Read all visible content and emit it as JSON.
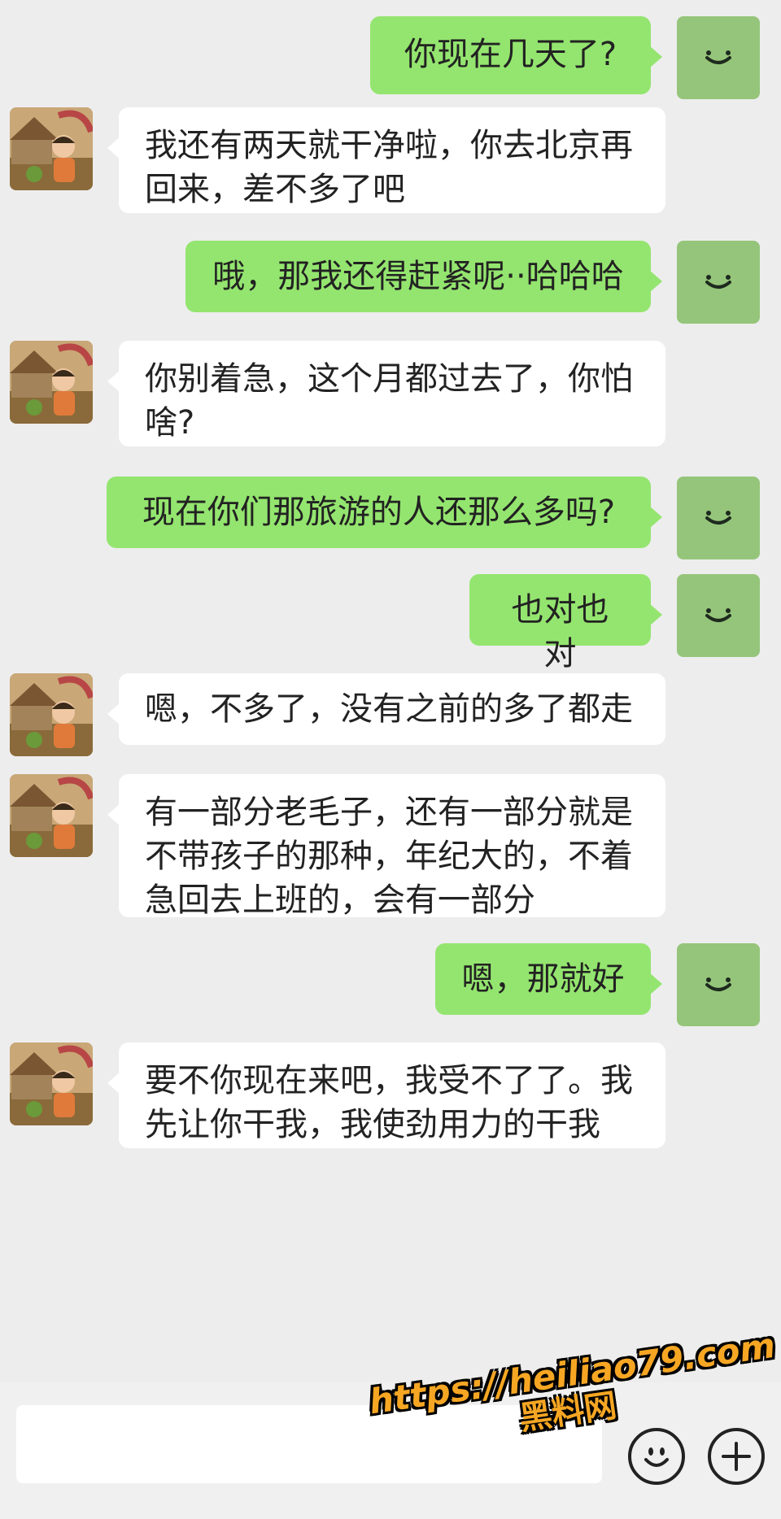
{
  "colors": {
    "background": "#ededed",
    "self_bubble": "#94e56f",
    "other_bubble": "#ffffff",
    "self_avatar": "#95c57a",
    "watermark": "#f6a623"
  },
  "messages": [
    {
      "sender": "self",
      "text": "你现在几天了?"
    },
    {
      "sender": "other",
      "lines": [
        "我还有两天就干净啦，你去北京再",
        "回来，差不多了吧"
      ]
    },
    {
      "sender": "self",
      "text": "哦，那我还得赶紧呢··哈哈哈"
    },
    {
      "sender": "other",
      "lines": [
        "你别着急，这个月都过去了，你怕",
        "啥?"
      ]
    },
    {
      "sender": "self",
      "text": "现在你们那旅游的人还那么多吗?"
    },
    {
      "sender": "self",
      "text": "也对也对"
    },
    {
      "sender": "other",
      "lines": [
        "嗯，不多了，没有之前的多了都走"
      ]
    },
    {
      "sender": "other",
      "lines": [
        "有一部分老毛子，还有一部分就是",
        "不带孩子的那种，年纪大的，不着",
        "急回去上班的，会有一部分"
      ]
    },
    {
      "sender": "self",
      "text": "嗯，那就好"
    },
    {
      "sender": "other",
      "lines": [
        "要不你现在来吧，我受不了了。我",
        "先让你干我，我使劲用力的干我"
      ]
    }
  ],
  "input_bar": {
    "emoji_icon": "smiley-face-icon",
    "more_icon": "plus-circle-icon"
  },
  "watermark": {
    "url": "https://heiliao79.com",
    "text": "黑料网"
  }
}
